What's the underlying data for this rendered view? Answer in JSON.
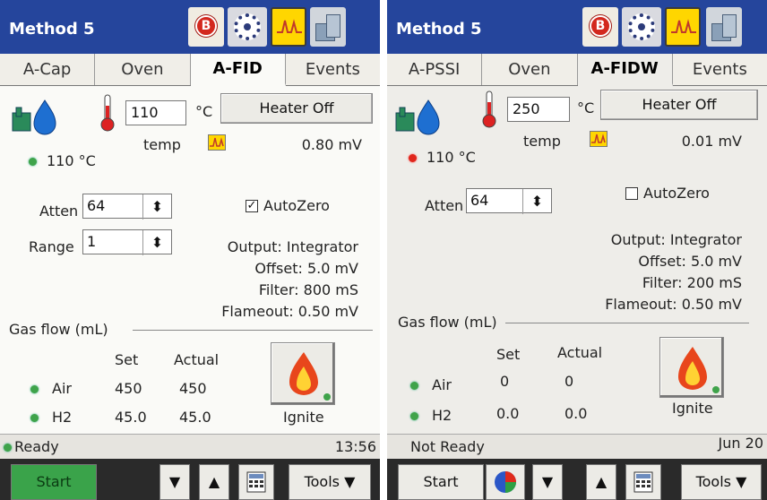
{
  "left": {
    "title": "Method 5",
    "tabs": [
      "A-Cap",
      "Oven",
      "A-FID",
      "Events"
    ],
    "temp_setpoint": "110",
    "temp_unit": "°C",
    "heater_button": "Heater Off",
    "temp_label": "temp",
    "signal_value": "0.80 mV",
    "actual_temp": "110 °C",
    "atten_label": "Atten",
    "atten_value": "64",
    "range_label": "Range",
    "range_value": "1",
    "autozero_label": "AutoZero",
    "autozero_checked": true,
    "output_lines": [
      "Output: Integrator",
      "Offset: 5.0    mV",
      "Filter: 800    mS",
      "Flameout: 0.50   mV"
    ],
    "gas_flow_label": "Gas flow (mL)",
    "col_set": "Set",
    "col_actual": "Actual",
    "air_label": "Air",
    "air_set": "450",
    "air_actual": "450",
    "h2_label": "H2",
    "h2_set": "45.0",
    "h2_actual": "45.0",
    "ignite_label": "Ignite",
    "status": "Ready",
    "time": "13:56",
    "start_label": "Start",
    "tools_label": "Tools"
  },
  "right": {
    "title": "Method 5",
    "tabs": [
      "A-PSSI",
      "Oven",
      "A-FIDW",
      "Events"
    ],
    "temp_setpoint": "250",
    "temp_unit": "°C",
    "heater_button": "Heater Off",
    "temp_label": "temp",
    "signal_value": "0.01 mV",
    "actual_temp": "110 °C",
    "atten_label": "Atten",
    "atten_value": "64",
    "autozero_label": "AutoZero",
    "autozero_checked": false,
    "output_lines": [
      "Output: Integrator",
      "Offset: 5.0    mV",
      "Filter: 200    mS",
      "Flameout: 0.50   mV"
    ],
    "gas_flow_label": "Gas flow (mL)",
    "col_set": "Set",
    "col_actual": "Actual",
    "air_label": "Air",
    "air_set": "0",
    "air_actual": "0",
    "h2_label": "H2",
    "h2_set": "0.0",
    "h2_actual": "0.0",
    "ignite_label": "Ignite",
    "status": "Not Ready",
    "date": "Jun 20",
    "start_label": "Start",
    "tools_label": "Tools"
  },
  "icons": {
    "b_letter": "B",
    "heater_icon": "thermometer-icon",
    "detector_icon": "fid-detector-icon"
  },
  "colors": {
    "titlebar": "#25459c",
    "led_ok": "#3fa34a",
    "led_error": "#e0261c",
    "start_green": "#3aa34a"
  }
}
